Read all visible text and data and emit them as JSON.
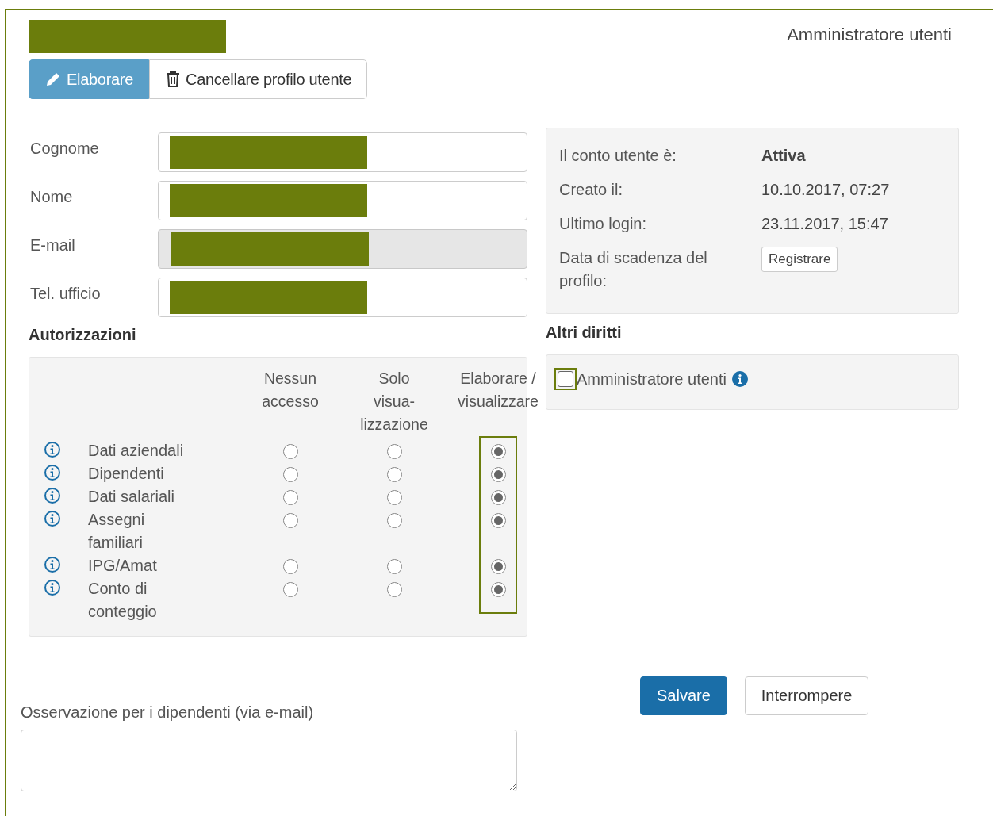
{
  "header": {
    "role": "Amministratore utenti"
  },
  "toolbar": [
    {
      "kind": "edit",
      "label": "Elaborare",
      "selected": true
    },
    {
      "kind": "delete",
      "label": "Cancellare profilo utente",
      "selected": false
    }
  ],
  "fields": [
    {
      "label": "Cognome",
      "disabled": false
    },
    {
      "label": "Nome",
      "disabled": false
    },
    {
      "label": "E-mail",
      "disabled": true
    },
    {
      "label": "Tel. ufficio",
      "disabled": false
    }
  ],
  "account": {
    "rows": [
      {
        "label": "Il conto utente è:",
        "value": "Attiva",
        "kind": "bold"
      },
      {
        "label": "Creato il:",
        "value": "10.10.2017, 07:27",
        "kind": "text"
      },
      {
        "label": "Ultimo login:",
        "value": "23.11.2017, 15:47",
        "kind": "text"
      },
      {
        "label": "Data di scadenza del profilo:",
        "value": "Registrare",
        "kind": "button"
      }
    ]
  },
  "permissions": {
    "title": "Autorizzazioni",
    "columns": [
      {
        "label": "Nessun accesso",
        "highlighted": false
      },
      {
        "label": "Solo visua- lizzazione",
        "highlighted": false
      },
      {
        "label": "Elaborare / visualizzare",
        "highlighted": true
      }
    ],
    "rows": [
      {
        "label": "Dati aziendali",
        "options": [
          {
            "selected": false
          },
          {
            "selected": false
          },
          {
            "selected": true
          }
        ]
      },
      {
        "label": "Dipendenti",
        "options": [
          {
            "selected": false
          },
          {
            "selected": false
          },
          {
            "selected": true
          }
        ]
      },
      {
        "label": "Dati salariali",
        "options": [
          {
            "selected": false
          },
          {
            "selected": false
          },
          {
            "selected": true
          }
        ]
      },
      {
        "label": "Assegni familiari",
        "options": [
          {
            "selected": false
          },
          {
            "selected": false
          },
          {
            "selected": true
          }
        ]
      },
      {
        "label": "IPG/Amat",
        "options": [
          {
            "selected": false
          },
          {
            "selected": false
          },
          {
            "selected": true
          }
        ]
      },
      {
        "label": "Conto di conteggio",
        "options": [
          {
            "selected": false
          },
          {
            "selected": false
          },
          {
            "selected": true
          }
        ]
      }
    ]
  },
  "other_rights": {
    "title": "Altri diritti",
    "items": [
      {
        "label": "Amministratore utenti",
        "checked": false,
        "highlighted": true
      }
    ]
  },
  "note": {
    "label": "Osservazione per i dipendenti (via e-mail)"
  },
  "actions": [
    {
      "kind": "primary",
      "label": "Salvare"
    },
    {
      "kind": "default",
      "label": "Interrompere"
    }
  ]
}
